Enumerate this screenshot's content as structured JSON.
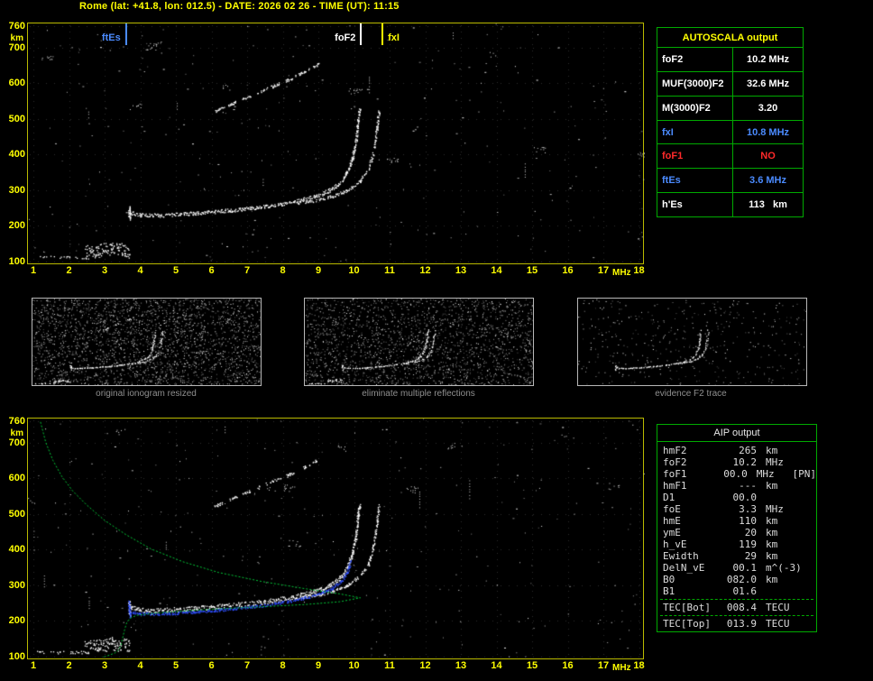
{
  "header": {
    "title": "Rome (lat: +41.8, lon: 012.5) - DATE: 2026 02 26 - TIME (UT): 11:15"
  },
  "palette": {
    "axis_yellow": "#ffff00",
    "border_yellow": "#b9b900",
    "table_green": "#00aa00",
    "profile_green": "#00c837",
    "trace_white": "#ffffff",
    "restored_blue": "#3050ff",
    "label_blue": "#4b8bff",
    "alarm_red": "#ff2a2a",
    "caption_gray": "#8f8f8f"
  },
  "autoscala_table": {
    "title": "AUTOSCALA output",
    "rows": [
      {
        "label": "foF2",
        "value": "10.2 MHz",
        "color": "#ffffff"
      },
      {
        "label": "MUF(3000)F2",
        "value": "32.6 MHz",
        "color": "#ffffff"
      },
      {
        "label": "M(3000)F2",
        "value": "3.20",
        "color": "#ffffff"
      },
      {
        "label": "fxI",
        "value": "10.8 MHz",
        "color": "#4b8bff"
      },
      {
        "label": "foF1",
        "value": "NO",
        "color": "#ff2a2a"
      },
      {
        "label": "ftEs",
        "value": "3.6 MHz",
        "color": "#4b8bff"
      },
      {
        "label": "h'Es",
        "value": "113   km",
        "color": "#ffffff"
      }
    ]
  },
  "aip_table": {
    "title": "AIP output",
    "rows": [
      {
        "label": "hmF2",
        "value": "265",
        "unit": "km"
      },
      {
        "label": "foF2",
        "value": "10.2",
        "unit": "MHz"
      },
      {
        "label": "foF1",
        "value": "00.0",
        "unit": "MHz   [PN]"
      },
      {
        "label": "hmF1",
        "value": "---",
        "unit": "km"
      },
      {
        "label": "D1",
        "value": "00.0",
        "unit": ""
      },
      {
        "label": "foE",
        "value": "3.3",
        "unit": "MHz"
      },
      {
        "label": "hmE",
        "value": "110",
        "unit": "km"
      },
      {
        "label": "ymE",
        "value": "20",
        "unit": "km"
      },
      {
        "label": "h_vE",
        "value": "119",
        "unit": "km"
      },
      {
        "label": "Ewidth",
        "value": "29",
        "unit": "km"
      },
      {
        "label": "DelN_vE",
        "value": "00.1",
        "unit": "m^(-3)"
      },
      {
        "label": "B0",
        "value": "082.0",
        "unit": "km"
      },
      {
        "label": "B1",
        "value": "01.6",
        "unit": ""
      }
    ],
    "tec_rows": [
      {
        "label": "TEC[Bot]",
        "value": "008.4",
        "unit": "TECU"
      },
      {
        "label": "TEC[Top]",
        "value": "013.9",
        "unit": "TECU"
      }
    ]
  },
  "thumbnails": {
    "items": [
      {
        "caption": "original ionogram resized",
        "noise_dots": 2600,
        "show": [
          "es",
          "f2",
          "fx",
          "hop2"
        ]
      },
      {
        "caption": "eliminate multiple reflections",
        "noise_dots": 2100,
        "show": [
          "es",
          "f2",
          "fx"
        ]
      },
      {
        "caption": "evidence F2 trace",
        "noise_dots": 420,
        "show": [
          "f2",
          "fx"
        ]
      }
    ]
  },
  "chart_data": [
    {
      "id": "ionogram_top",
      "type": "scatter",
      "title": "Ionogram with autoscaled characteristic frequencies",
      "xlabel": "MHz",
      "ylabel": "km",
      "xlim": [
        1,
        18
      ],
      "ylim": [
        100,
        760
      ],
      "x_ticks": [
        1,
        2,
        3,
        4,
        5,
        6,
        7,
        8,
        9,
        10,
        11,
        12,
        13,
        14,
        15,
        16,
        17,
        18
      ],
      "y_ticks": [
        760,
        700,
        600,
        500,
        400,
        300,
        200,
        100
      ],
      "grid": true,
      "noise_dots": 280,
      "markers": [
        {
          "label": "ftEs",
          "x": 3.6,
          "color": "#4b8bff",
          "side": "left"
        },
        {
          "label": "foF2",
          "x": 10.2,
          "color": "#ffffff",
          "side": "left"
        },
        {
          "label": "fxI",
          "x": 10.8,
          "color": "#ffff00",
          "side": "right"
        }
      ],
      "series": [
        {
          "tag": "es",
          "name": "Es layer thin trace",
          "color": "#ffffff",
          "points": [
            [
              1.1,
              113
            ],
            [
              2.45,
              113
            ]
          ],
          "thickness_px": 3,
          "skip": 0.45,
          "density": 1
        },
        {
          "tag": "es",
          "name": "Es layer dense patch",
          "color": "#ffffff",
          "points": [
            [
              2.45,
              126
            ],
            [
              2.8,
              133
            ],
            [
              3.2,
              137
            ],
            [
              3.55,
              133
            ],
            [
              3.68,
              128
            ]
          ],
          "thickness_px": 15,
          "skip": 0.04,
          "density": 3
        },
        {
          "tag": "f2",
          "name": "F2 ordinary trace",
          "color": "#ffffff",
          "points": [
            [
              3.68,
              252
            ],
            [
              3.72,
              238
            ],
            [
              4.0,
              232
            ],
            [
              4.5,
              230
            ],
            [
              5.5,
              236
            ],
            [
              6.5,
              244
            ],
            [
              7.5,
              255
            ],
            [
              8.3,
              268
            ],
            [
              8.9,
              283
            ],
            [
              9.3,
              300
            ],
            [
              9.6,
              320
            ],
            [
              9.8,
              350
            ],
            [
              9.95,
              390
            ],
            [
              10.05,
              440
            ],
            [
              10.1,
              490
            ],
            [
              10.15,
              528
            ]
          ],
          "thickness_px": 4,
          "skip": 0.1,
          "density": 2
        },
        {
          "tag": "f2",
          "name": "F2 leading cusp",
          "color": "#ffffff",
          "points": [
            [
              3.7,
              218
            ],
            [
              3.68,
              250
            ]
          ],
          "thickness_px": 5,
          "skip": 0.15,
          "density": 2
        },
        {
          "tag": "fx",
          "name": "F2 extraordinary trace",
          "color": "#ffffff",
          "points": [
            [
              8.4,
              265
            ],
            [
              8.9,
              272
            ],
            [
              9.4,
              284
            ],
            [
              9.8,
              300
            ],
            [
              10.15,
              325
            ],
            [
              10.4,
              360
            ],
            [
              10.52,
              400
            ],
            [
              10.6,
              445
            ],
            [
              10.66,
              495
            ],
            [
              10.7,
              525
            ]
          ],
          "thickness_px": 3,
          "skip": 0.3,
          "density": 2
        },
        {
          "tag": "hop2",
          "name": "second hop reflection",
          "color": "#ffffff",
          "dash_band": true,
          "points": [
            [
              6.1,
              523
            ],
            [
              6.6,
              545
            ],
            [
              7.1,
              566
            ],
            [
              7.6,
              588
            ],
            [
              8.1,
              608
            ],
            [
              8.6,
              632
            ],
            [
              9.0,
              655
            ]
          ],
          "thickness_px": 3,
          "skip": 0.2,
          "density": 2
        }
      ]
    },
    {
      "id": "ionogram_bottom_profile",
      "type": "scatter",
      "title": "Ionogram with restored trace and electron density profile",
      "xlabel": "MHz",
      "ylabel": "km",
      "xlim": [
        1,
        18
      ],
      "ylim": [
        100,
        760
      ],
      "x_ticks": [
        1,
        2,
        3,
        4,
        5,
        6,
        7,
        8,
        9,
        10,
        11,
        12,
        13,
        14,
        15,
        16,
        17,
        18
      ],
      "y_ticks": [
        760,
        700,
        600,
        500,
        400,
        300,
        200,
        100
      ],
      "grid": true,
      "noise_dots": 260,
      "markers": [],
      "series": [
        {
          "tag": "es",
          "name": "Es layer thin trace",
          "color": "#ffffff",
          "points": [
            [
              1.1,
              113
            ],
            [
              2.45,
              113
            ]
          ],
          "thickness_px": 3,
          "skip": 0.45,
          "density": 1
        },
        {
          "tag": "es",
          "name": "Es layer dense patch",
          "color": "#ffffff",
          "points": [
            [
              2.45,
              126
            ],
            [
              2.8,
              133
            ],
            [
              3.2,
              137
            ],
            [
              3.55,
              133
            ],
            [
              3.68,
              128
            ]
          ],
          "thickness_px": 15,
          "skip": 0.04,
          "density": 3
        },
        {
          "tag": "f2",
          "name": "F2 ordinary trace",
          "color": "#ffffff",
          "points": [
            [
              3.68,
              252
            ],
            [
              3.72,
              238
            ],
            [
              4.0,
              232
            ],
            [
              4.5,
              230
            ],
            [
              5.5,
              236
            ],
            [
              6.5,
              244
            ],
            [
              7.5,
              255
            ],
            [
              8.3,
              268
            ],
            [
              8.9,
              283
            ],
            [
              9.3,
              300
            ],
            [
              9.6,
              320
            ],
            [
              9.8,
              350
            ],
            [
              9.95,
              390
            ],
            [
              10.05,
              440
            ],
            [
              10.1,
              490
            ],
            [
              10.15,
              528
            ]
          ],
          "thickness_px": 5,
          "skip": 0.1,
          "density": 2
        },
        {
          "tag": "f2",
          "name": "F2 leading cusp",
          "color": "#ffffff",
          "points": [
            [
              3.7,
              218
            ],
            [
              3.68,
              250
            ]
          ],
          "thickness_px": 5,
          "skip": 0.15,
          "density": 2
        },
        {
          "tag": "fx",
          "name": "F2 extraordinary trace",
          "color": "#ffffff",
          "points": [
            [
              8.4,
              265
            ],
            [
              8.9,
              272
            ],
            [
              9.4,
              284
            ],
            [
              9.8,
              300
            ],
            [
              10.15,
              325
            ],
            [
              10.4,
              360
            ],
            [
              10.52,
              400
            ],
            [
              10.6,
              445
            ],
            [
              10.66,
              495
            ],
            [
              10.7,
              525
            ]
          ],
          "thickness_px": 3,
          "skip": 0.3,
          "density": 2
        },
        {
          "tag": "hop2",
          "name": "second hop reflection",
          "color": "#ffffff",
          "dash_band": true,
          "points": [
            [
              6.1,
              523
            ],
            [
              6.6,
              545
            ],
            [
              7.1,
              566
            ],
            [
              7.6,
              588
            ],
            [
              8.1,
              608
            ],
            [
              8.6,
              632
            ],
            [
              9.0,
              655
            ]
          ],
          "thickness_px": 3,
          "skip": 0.2,
          "density": 2
        },
        {
          "tag": "fit",
          "name": "autoscaled restored trace",
          "color": "#3050ff",
          "points": [
            [
              3.7,
              226
            ],
            [
              4.0,
              222
            ],
            [
              4.5,
              220
            ],
            [
              5.5,
              226
            ],
            [
              6.5,
              234
            ],
            [
              7.5,
              245
            ],
            [
              8.3,
              258
            ],
            [
              8.9,
              272
            ],
            [
              9.3,
              288
            ],
            [
              9.6,
              308
            ],
            [
              9.8,
              335
            ],
            [
              9.9,
              368
            ]
          ],
          "thickness_px": 3,
          "skip": 0.15,
          "density": 2
        },
        {
          "tag": "fit",
          "name": "restored trace cusp",
          "color": "#3050ff",
          "points": [
            [
              3.7,
              214
            ],
            [
              3.68,
              256
            ]
          ],
          "thickness_px": 4,
          "skip": 0.15,
          "density": 2
        },
        {
          "tag": "profile",
          "type": "line",
          "name": "electron density profile N(h)",
          "color": "#00c837",
          "dashed": [
            2,
            2
          ],
          "points": [
            [
              1.2,
              758
            ],
            [
              1.35,
              700
            ],
            [
              1.55,
              650
            ],
            [
              1.8,
              605
            ],
            [
              2.1,
              565
            ],
            [
              2.5,
              525
            ],
            [
              3.0,
              482
            ],
            [
              3.6,
              442
            ],
            [
              4.3,
              402
            ],
            [
              5.2,
              366
            ],
            [
              6.2,
              336
            ],
            [
              7.4,
              311
            ],
            [
              8.6,
              291
            ],
            [
              9.6,
              276
            ],
            [
              10.18,
              265
            ],
            [
              9.6,
              254
            ],
            [
              8.6,
              246
            ],
            [
              7.4,
              240
            ],
            [
              6.2,
              234
            ],
            [
              5.2,
              228
            ],
            [
              4.4,
              222
            ],
            [
              3.9,
              216
            ],
            [
              3.72,
              208
            ],
            [
              3.62,
              195
            ],
            [
              3.56,
              175
            ],
            [
              3.5,
              150
            ],
            [
              3.46,
              132
            ],
            [
              3.4,
              120
            ],
            [
              3.3,
              111
            ],
            [
              3.1,
              103
            ],
            [
              2.92,
              97
            ]
          ]
        }
      ]
    }
  ]
}
